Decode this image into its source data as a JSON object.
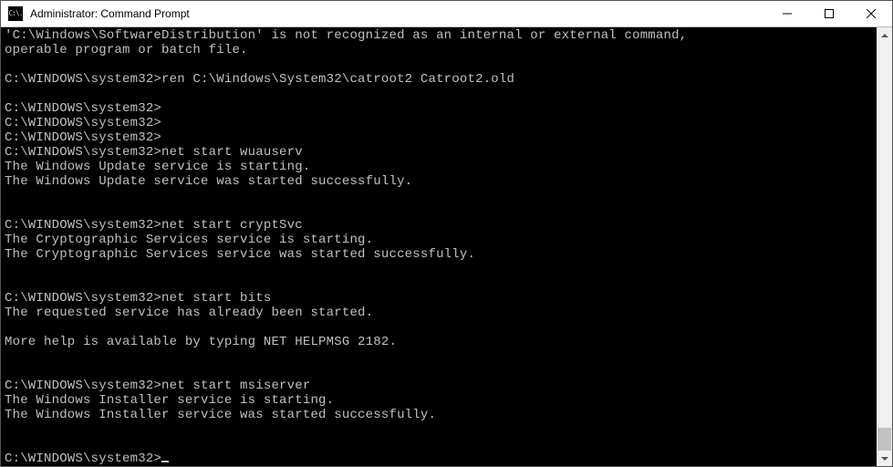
{
  "window": {
    "title": "Administrator: Command Prompt",
    "icon_glyph": "C:\\."
  },
  "terminal": {
    "lines": [
      "'C:\\Windows\\SoftwareDistribution' is not recognized as an internal or external command,",
      "operable program or batch file.",
      "",
      "C:\\WINDOWS\\system32>ren C:\\Windows\\System32\\catroot2 Catroot2.old",
      "",
      "C:\\WINDOWS\\system32>",
      "C:\\WINDOWS\\system32>",
      "C:\\WINDOWS\\system32>",
      "C:\\WINDOWS\\system32>net start wuauserv",
      "The Windows Update service is starting.",
      "The Windows Update service was started successfully.",
      "",
      "",
      "C:\\WINDOWS\\system32>net start cryptSvc",
      "The Cryptographic Services service is starting.",
      "The Cryptographic Services service was started successfully.",
      "",
      "",
      "C:\\WINDOWS\\system32>net start bits",
      "The requested service has already been started.",
      "",
      "More help is available by typing NET HELPMSG 2182.",
      "",
      "",
      "C:\\WINDOWS\\system32>net start msiserver",
      "The Windows Installer service is starting.",
      "The Windows Installer service was started successfully.",
      "",
      "",
      "C:\\WINDOWS\\system32>"
    ]
  }
}
